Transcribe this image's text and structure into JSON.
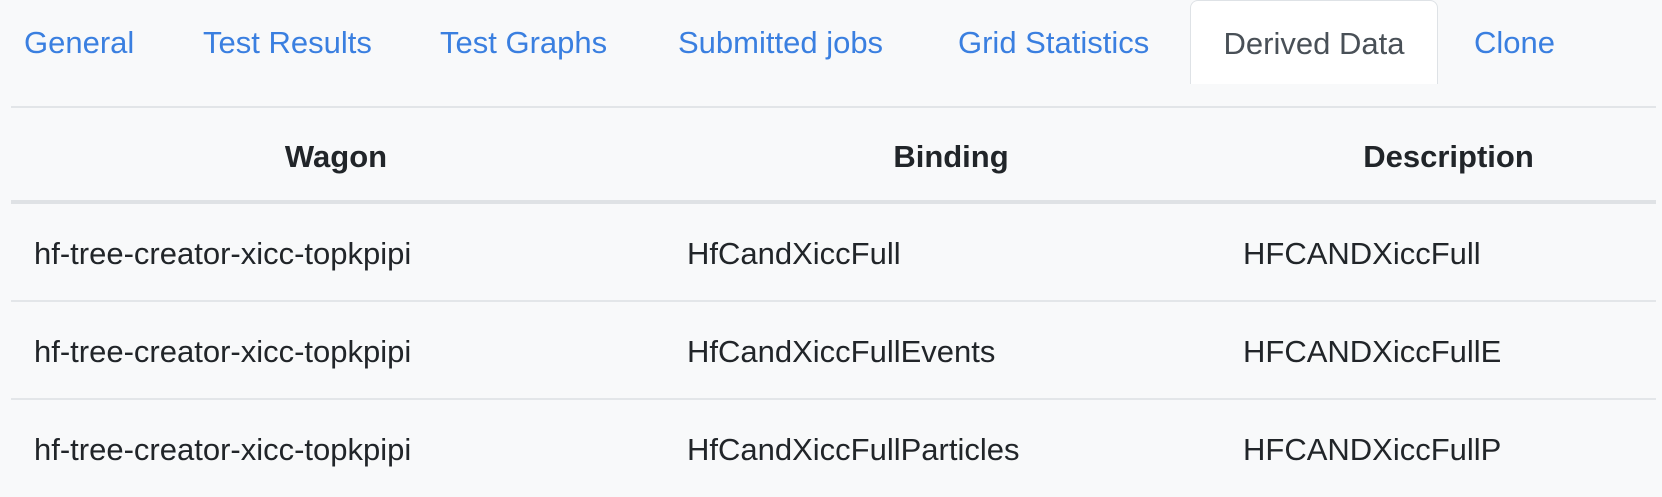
{
  "tabs": [
    {
      "label": "General",
      "active": false
    },
    {
      "label": "Test Results",
      "active": false
    },
    {
      "label": "Test Graphs",
      "active": false
    },
    {
      "label": "Submitted jobs",
      "active": false
    },
    {
      "label": "Grid Statistics",
      "active": false
    },
    {
      "label": "Derived Data",
      "active": true
    },
    {
      "label": "Clone",
      "active": false
    }
  ],
  "table": {
    "columns": [
      "Wagon",
      "Binding",
      "Description"
    ],
    "rows": [
      {
        "wagon": "hf-tree-creator-xicc-topkpipi",
        "binding": "HfCandXiccFull",
        "description": "HFCANDXiccFull"
      },
      {
        "wagon": "hf-tree-creator-xicc-topkpipi",
        "binding": "HfCandXiccFullEvents",
        "description": "HFCANDXiccFullE"
      },
      {
        "wagon": "hf-tree-creator-xicc-topkpipi",
        "binding": "HfCandXiccFullParticles",
        "description": "HFCANDXiccFullP"
      }
    ]
  },
  "colors": {
    "link": "#3a7fe0",
    "active_tab_text": "#495057",
    "text": "#212529",
    "background": "#f8f9fa"
  }
}
